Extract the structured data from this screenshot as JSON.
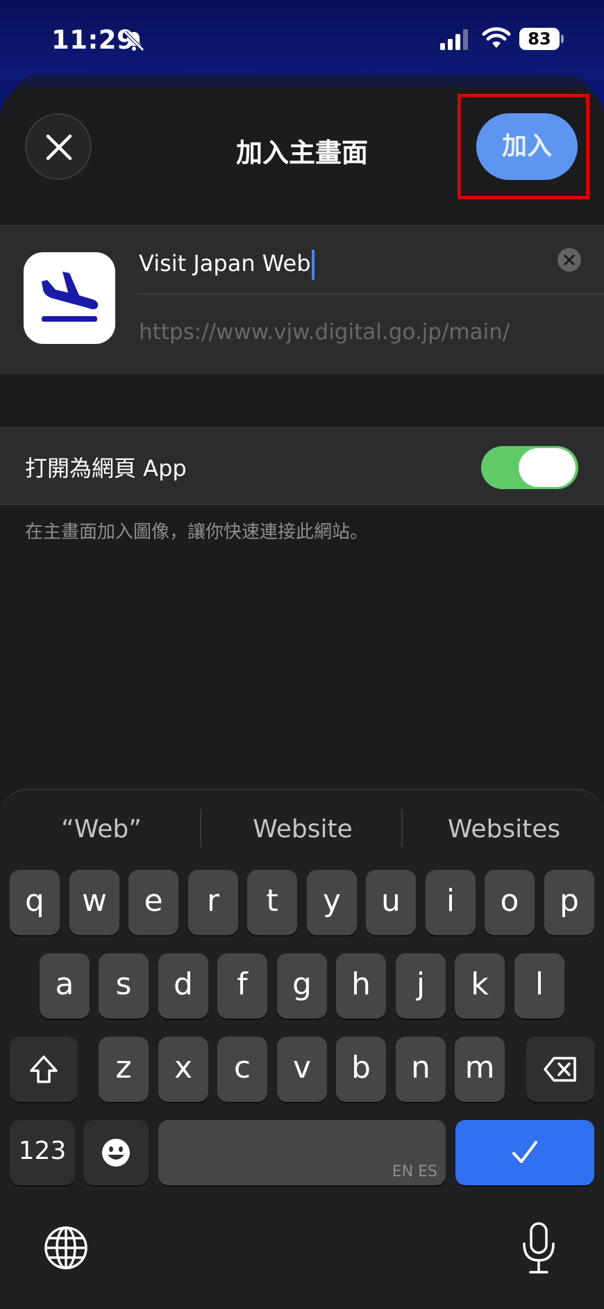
{
  "status_bar": {
    "time": "11:29",
    "battery": "83"
  },
  "header": {
    "title": "加入主畫面",
    "add_label": "加入"
  },
  "app_info": {
    "name_value": "Visit Japan Web",
    "url": "https://www.vjw.digital.go.jp/main/"
  },
  "settings": {
    "web_app_label": "打開為網頁 App",
    "web_app_enabled": true,
    "footnote": "在主畫面加入圖像，讓你快速連接此網站。"
  },
  "keyboard": {
    "suggestions": [
      "“Web”",
      "Website",
      "Websites"
    ],
    "row1": [
      "q",
      "w",
      "e",
      "r",
      "t",
      "y",
      "u",
      "i",
      "o",
      "p"
    ],
    "row2": [
      "a",
      "s",
      "d",
      "f",
      "g",
      "h",
      "j",
      "k",
      "l"
    ],
    "row3": [
      "z",
      "x",
      "c",
      "v",
      "b",
      "n",
      "m"
    ],
    "numbers_label": "123",
    "space_languages": "EN ES"
  },
  "icons": {
    "close": "close-icon",
    "clear": "clear-icon",
    "app": "airplane-arrival-icon",
    "shift": "shift-icon",
    "delete": "delete-icon",
    "emoji": "emoji-icon",
    "done": "checkmark-icon",
    "globe": "globe-icon",
    "mic": "microphone-icon",
    "bell": "bell-slash-icon",
    "signal": "signal-icon",
    "wifi": "wifi-icon"
  },
  "colors": {
    "accent": "#5e95f0",
    "toggle_on": "#5ecb67",
    "highlight": "#e00000",
    "done_key": "#2f6ff0",
    "app_icon_blue": "#1a1aa8"
  }
}
